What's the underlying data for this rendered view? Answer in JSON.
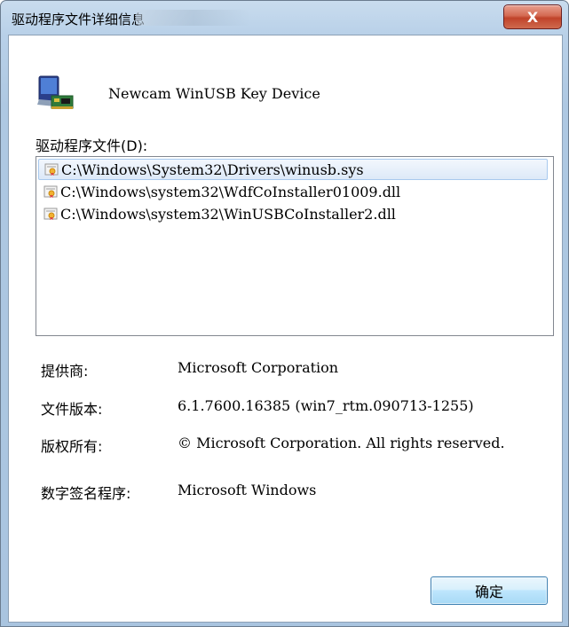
{
  "window": {
    "title": "驱动程序文件详细信息",
    "close_glyph": "X"
  },
  "device": {
    "name": "Newcam WinUSB Key Device",
    "icon": "device-driver-icon"
  },
  "files": {
    "label": "驱动程序文件(D):",
    "items": [
      {
        "path": "C:\\Windows\\System32\\Drivers\\winusb.sys",
        "icon": "driver-file-icon",
        "selected": true
      },
      {
        "path": "C:\\Windows\\system32\\WdfCoInstaller01009.dll",
        "icon": "driver-file-icon",
        "selected": false
      },
      {
        "path": "C:\\Windows\\system32\\WinUSBCoInstaller2.dll",
        "icon": "driver-file-icon",
        "selected": false
      }
    ]
  },
  "properties": {
    "provider": {
      "label": "提供商:",
      "value": "Microsoft Corporation"
    },
    "version": {
      "label": "文件版本:",
      "value": "6.1.7600.16385 (win7_rtm.090713-1255)"
    },
    "copyright": {
      "label": "版权所有:",
      "value": "© Microsoft Corporation. All rights reserved."
    },
    "signer": {
      "label": "数字签名程序:",
      "value": "Microsoft Windows"
    }
  },
  "buttons": {
    "ok_label": "确定"
  },
  "colors": {
    "title_bar": "#b8d0e8",
    "close_button": "#c0432a",
    "selection": "#dde9f8",
    "ok_button": "#bee6fd"
  }
}
